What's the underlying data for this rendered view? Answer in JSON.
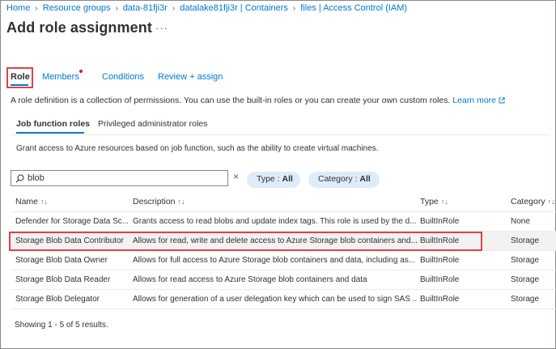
{
  "breadcrumb": [
    "Home",
    "Resource groups",
    "data-81fji3r",
    "datalake81fji3r | Containers",
    "files | Access Control (IAM)"
  ],
  "page": {
    "title": "Add role assignment",
    "more": "···"
  },
  "tabs": {
    "role": "Role",
    "members": "Members",
    "conditions": "Conditions",
    "review": "Review + assign"
  },
  "description": {
    "text": "A role definition is a collection of permissions. You can use the built-in roles or you can create your own custom roles.",
    "learn_more": "Learn more"
  },
  "subtabs": {
    "job_function": "Job function roles",
    "privileged": "Privileged administrator roles"
  },
  "grant_text": "Grant access to Azure resources based on job function, such as the ability to create virtual machines.",
  "search": {
    "value": "blob",
    "clear": "×"
  },
  "filters": {
    "type_label": "Type : ",
    "type_value": "All",
    "category_label": "Category : ",
    "category_value": "All"
  },
  "table": {
    "headers": {
      "name": "Name",
      "description": "Description",
      "type": "Type",
      "category": "Category"
    },
    "sort_glyph": "↑↓",
    "rows": [
      {
        "name": "Defender for Storage Data Sc...",
        "description": "Grants access to read blobs and update index tags. This role is used by the d...",
        "type": "BuiltInRole",
        "category": "None"
      },
      {
        "name": "Storage Blob Data Contributor",
        "description": "Allows for read, write and delete access to Azure Storage blob containers and...",
        "type": "BuiltInRole",
        "category": "Storage"
      },
      {
        "name": "Storage Blob Data Owner",
        "description": "Allows for full access to Azure Storage blob containers and data, including as...",
        "type": "BuiltInRole",
        "category": "Storage"
      },
      {
        "name": "Storage Blob Data Reader",
        "description": "Allows for read access to Azure Storage blob containers and data",
        "type": "BuiltInRole",
        "category": "Storage"
      },
      {
        "name": "Storage Blob Delegator",
        "description": "Allows for generation of a user delegation key which can be used to sign SAS ...",
        "type": "BuiltInRole",
        "category": "Storage"
      }
    ]
  },
  "results_text": "Showing 1 - 5 of 5 results.",
  "colors": {
    "accent": "#0078d4",
    "highlight": "#e04343",
    "pill": "#deecf9"
  }
}
